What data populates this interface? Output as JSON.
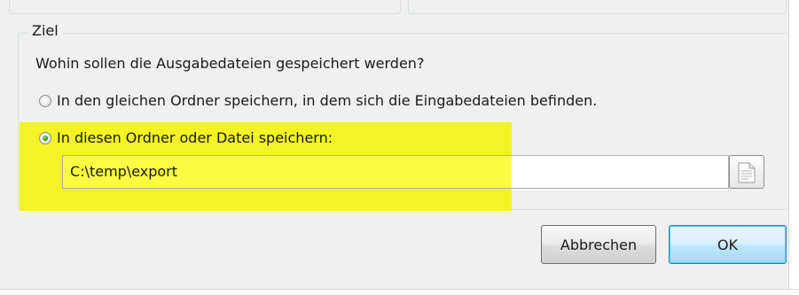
{
  "group": {
    "legend": "Ziel",
    "question": "Wohin sollen die Ausgabedateien gespeichert werden?"
  },
  "options": {
    "same_folder": {
      "label": "In den gleichen Ordner speichern, in dem sich die Eingabedateien befinden.",
      "checked": false
    },
    "custom_folder": {
      "label": "In diesen Ordner oder Datei speichern:",
      "checked": true
    }
  },
  "path_field": {
    "value": "C:\\temp\\export"
  },
  "buttons": {
    "cancel": "Abbrechen",
    "ok": "OK"
  },
  "colors": {
    "highlight": "#f3f315",
    "radio_checked": "#2f9a1e",
    "ok_border": "#3c7fb1"
  },
  "icons": {
    "browse": "document-icon"
  }
}
